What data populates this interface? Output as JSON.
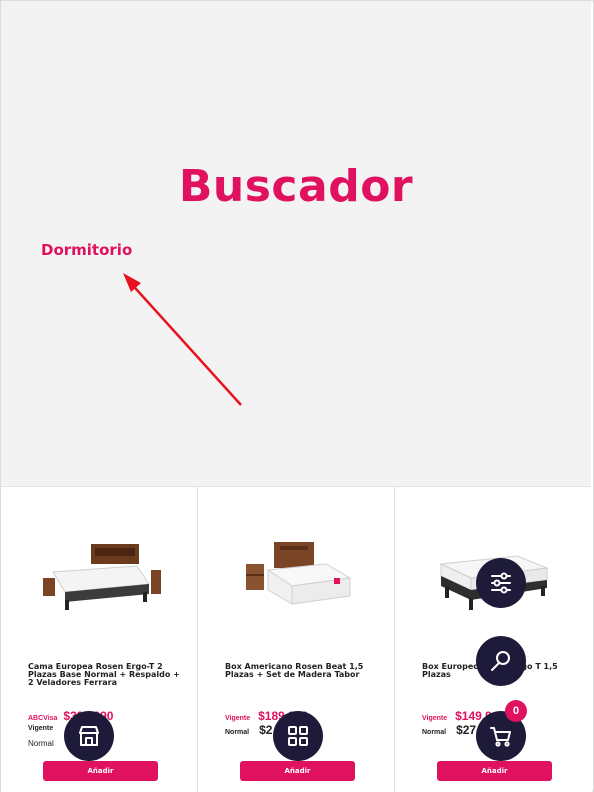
{
  "hero": {
    "title": "Buscador",
    "breadcrumb": "Dormitorio"
  },
  "colors": {
    "accent": "#e0115f",
    "fab": "#1e1b3a",
    "hero_bg": "#f3f3f3"
  },
  "products": [
    {
      "title": "Cama Europea Rosen Ergo-T 2 Plazas Base Normal + Respaldo + 2 Veladores Ferrara",
      "price_rows": [
        {
          "label": "ABCVisa",
          "price": "$399.990"
        },
        {
          "label": "Vigente",
          "price": ""
        },
        {
          "label": "Normal",
          "price": ""
        }
      ],
      "button": "Añadir"
    },
    {
      "title": "Box Americano Rosen Beat 1,5 Plazas + Set de Madera Tabor",
      "price_rows": [
        {
          "label": "Vigente",
          "price": "$189.990"
        },
        {
          "label": "Normal",
          "price": "$2"
        }
      ],
      "button": "Añadir"
    },
    {
      "title": "Box Europeo Rosen Ergo T 1,5 Plazas",
      "price_rows": [
        {
          "label": "Vigente",
          "price": "$149.9"
        },
        {
          "label": "Normal",
          "price": "$27"
        }
      ],
      "button": "Añadir"
    }
  ],
  "fabs": {
    "filter_icon": "sliders-icon",
    "search_icon": "search-icon",
    "store_icon": "store-icon",
    "grid_icon": "grid-icon",
    "cart_icon": "cart-icon",
    "cart_count": "0"
  }
}
